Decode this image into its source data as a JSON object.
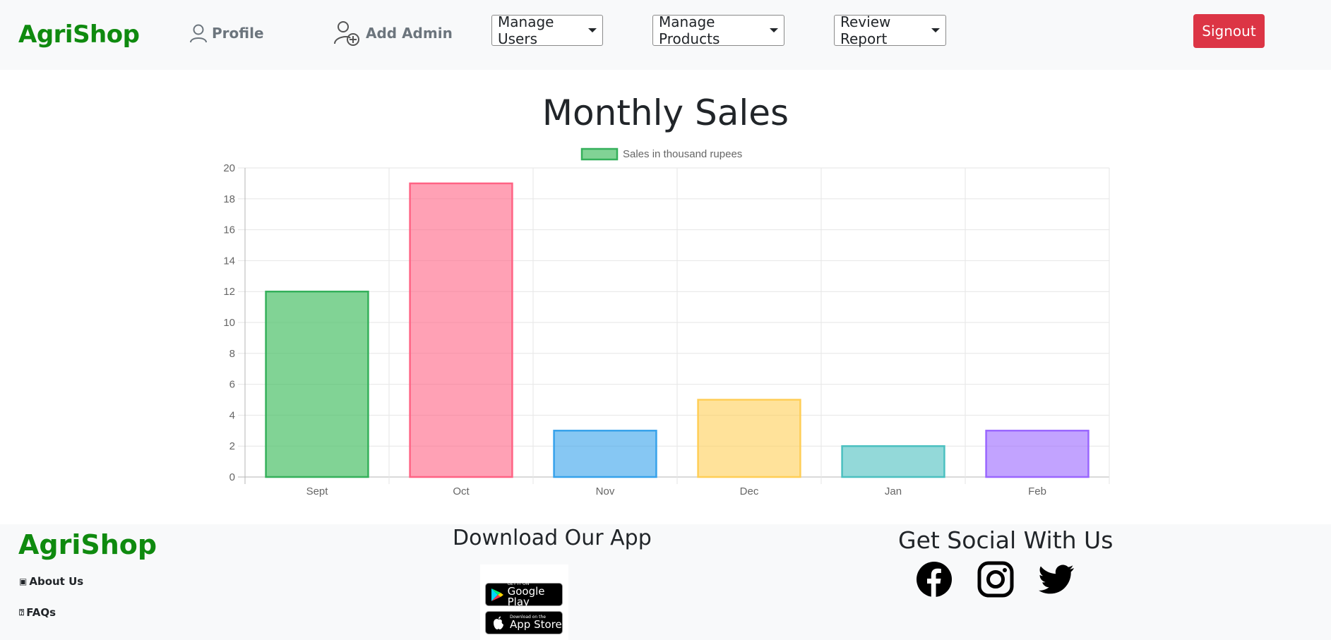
{
  "navbar": {
    "brand": "AgriShop",
    "profile_label": "Profile",
    "add_admin_label": "Add Admin",
    "manage_users_label": "Manage Users",
    "manage_products_label": "Manage Products",
    "review_report_label": "Review Report",
    "signout_label": "Signout",
    "brand_color": "#0f8a0f",
    "signout_color": "#dc3545"
  },
  "page_title": "Monthly Sales",
  "chart_data": {
    "type": "bar",
    "title": "Monthly Sales",
    "categories": [
      "Sept",
      "Oct",
      "Nov",
      "Dec",
      "Jan",
      "Feb"
    ],
    "series": [
      {
        "name": "Sales in thousand rupees",
        "values": [
          12,
          19,
          3,
          5,
          2,
          3
        ]
      }
    ],
    "ylim": [
      0,
      20
    ],
    "yticks": [
      0,
      2,
      4,
      6,
      8,
      10,
      12,
      14,
      16,
      18,
      20
    ],
    "grid": true,
    "legend": "top-center",
    "fill_colors": [
      "rgba(75,192,104,0.7)",
      "rgba(255,99,132,0.6)",
      "rgba(54,162,235,0.6)",
      "rgba(255,206,86,0.6)",
      "rgba(75,192,192,0.6)",
      "rgba(153,102,255,0.6)"
    ],
    "border_colors": [
      "#35b05b",
      "#ff6384",
      "#36a2eb",
      "#ffce56",
      "#4bc0c0",
      "#9966ff"
    ],
    "legend_fill": "rgba(75,192,104,0.7)",
    "legend_border": "#35b05b"
  },
  "footer": {
    "brand": "AgriShop",
    "about_label": "About Us",
    "faqs_label": "FAQs",
    "download_heading": "Download Our App",
    "google_play_small": "GET IT ON",
    "google_play_big": "Google Play",
    "app_store_small": "Download on the",
    "app_store_big": "App Store",
    "social_heading": "Get Social With Us",
    "social_icons": [
      "facebook-icon",
      "instagram-icon",
      "twitter-icon"
    ]
  }
}
